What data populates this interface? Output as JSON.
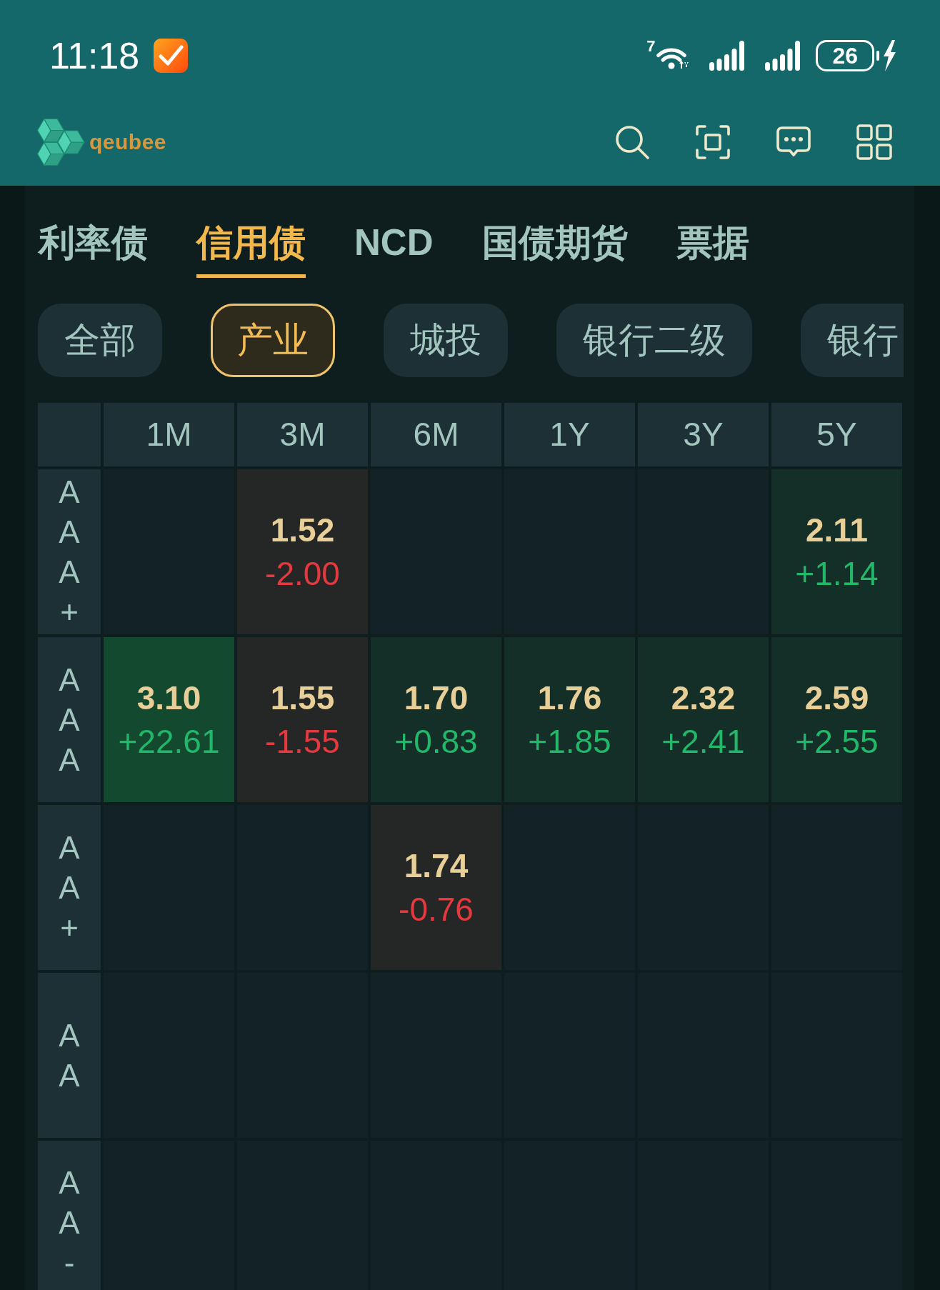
{
  "status_bar": {
    "time": "11:18",
    "wifi_label": "7",
    "battery": "26"
  },
  "header": {
    "logo_text": "qeubee"
  },
  "tabs": [
    {
      "label": "利率债",
      "selected": false
    },
    {
      "label": "信用债",
      "selected": true
    },
    {
      "label": "NCD",
      "selected": false
    },
    {
      "label": "国债期货",
      "selected": false
    },
    {
      "label": "票据",
      "selected": false
    }
  ],
  "chips": [
    {
      "label": "全部",
      "selected": false
    },
    {
      "label": "产业",
      "selected": true
    },
    {
      "label": "城投",
      "selected": false
    },
    {
      "label": "银行二级",
      "selected": false
    },
    {
      "label": "银行",
      "selected": false
    }
  ],
  "table": {
    "columns": [
      "1M",
      "3M",
      "6M",
      "1Y",
      "3Y",
      "5Y"
    ],
    "rows": [
      {
        "rating": "AAA+",
        "cells": [
          null,
          {
            "yield": "1.52",
            "change": "-2.00",
            "kind": "down",
            "strong": false
          },
          null,
          null,
          null,
          {
            "yield": "2.11",
            "change": "+1.14",
            "kind": "up",
            "strong": false
          }
        ]
      },
      {
        "rating": "AAA",
        "cells": [
          {
            "yield": "3.10",
            "change": "+22.61",
            "kind": "up",
            "strong": true
          },
          {
            "yield": "1.55",
            "change": "-1.55",
            "kind": "down",
            "strong": false
          },
          {
            "yield": "1.70",
            "change": "+0.83",
            "kind": "up",
            "strong": false
          },
          {
            "yield": "1.76",
            "change": "+1.85",
            "kind": "up",
            "strong": false
          },
          {
            "yield": "2.32",
            "change": "+2.41",
            "kind": "up",
            "strong": false
          },
          {
            "yield": "2.59",
            "change": "+2.55",
            "kind": "up",
            "strong": false
          }
        ]
      },
      {
        "rating": "AA+",
        "cells": [
          null,
          null,
          {
            "yield": "1.74",
            "change": "-0.76",
            "kind": "down",
            "strong": false
          },
          null,
          null,
          null
        ]
      },
      {
        "rating": "AA",
        "cells": [
          null,
          null,
          null,
          null,
          null,
          null
        ]
      },
      {
        "rating": "AA-",
        "cells": [
          null,
          null,
          null,
          null,
          null,
          null
        ]
      }
    ]
  }
}
